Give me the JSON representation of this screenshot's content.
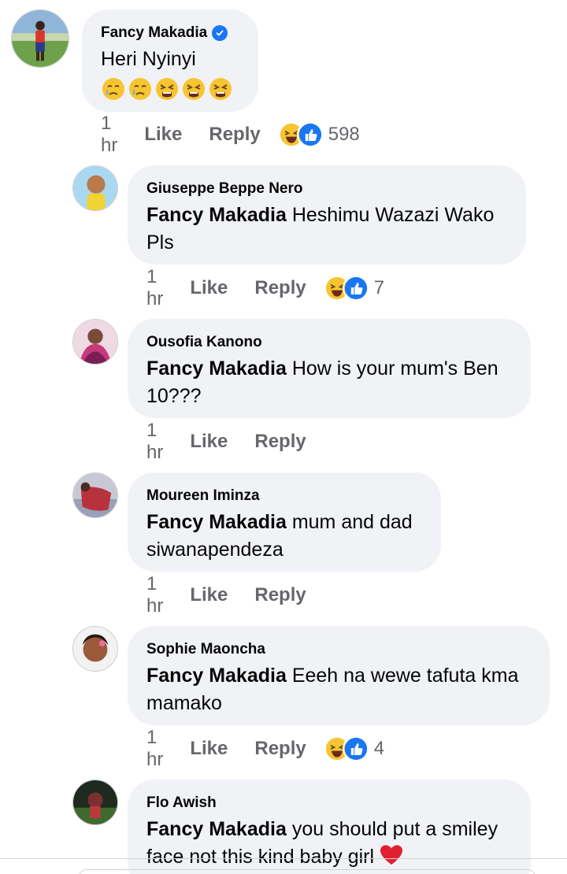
{
  "comments": [
    {
      "author": "Fancy Makadia",
      "verified": true,
      "tag": "",
      "text": "Heri Nyinyi",
      "emojis": [
        "crying-face",
        "crying-face",
        "tired-face",
        "tired-face",
        "tired-face"
      ],
      "time": "1 hr",
      "like_label": "Like",
      "reply_label": "Reply",
      "reaction_count": "598"
    },
    {
      "author": "Giuseppe Beppe Nero",
      "tag": "Fancy Makadia",
      "text": "Heshimu Wazazi Wako Pls",
      "time": "1 hr",
      "like_label": "Like",
      "reply_label": "Reply",
      "reaction_count": "7"
    },
    {
      "author": "Ousofia Kanono",
      "tag": "Fancy Makadia",
      "text": "How is your mum's Ben 10???",
      "time": "1 hr",
      "like_label": "Like",
      "reply_label": "Reply",
      "reaction_count": ""
    },
    {
      "author": "Moureen Iminza",
      "tag": "Fancy Makadia",
      "text": "mum and dad siwanapendeza",
      "time": "1 hr",
      "like_label": "Like",
      "reply_label": "Reply",
      "reaction_count": ""
    },
    {
      "author": "Sophie Maoncha",
      "tag": "Fancy Makadia",
      "text": "Eeeh na wewe tafuta kma mamako",
      "time": "1 hr",
      "like_label": "Like",
      "reply_label": "Reply",
      "reaction_count": "4"
    },
    {
      "author": "Flo Awish",
      "tag": "Fancy Makadia",
      "text": "you should put a smiley face not this kind baby girl",
      "text_emoji": "red-heart"
    }
  ],
  "colors": {
    "bubble": "#f0f2f5",
    "meta_text": "#65676b",
    "verified_blue": "#1877f2",
    "like_blue": "#1877f2",
    "emoji_yellow": "#f7c531",
    "heart_red": "#e0202e"
  }
}
